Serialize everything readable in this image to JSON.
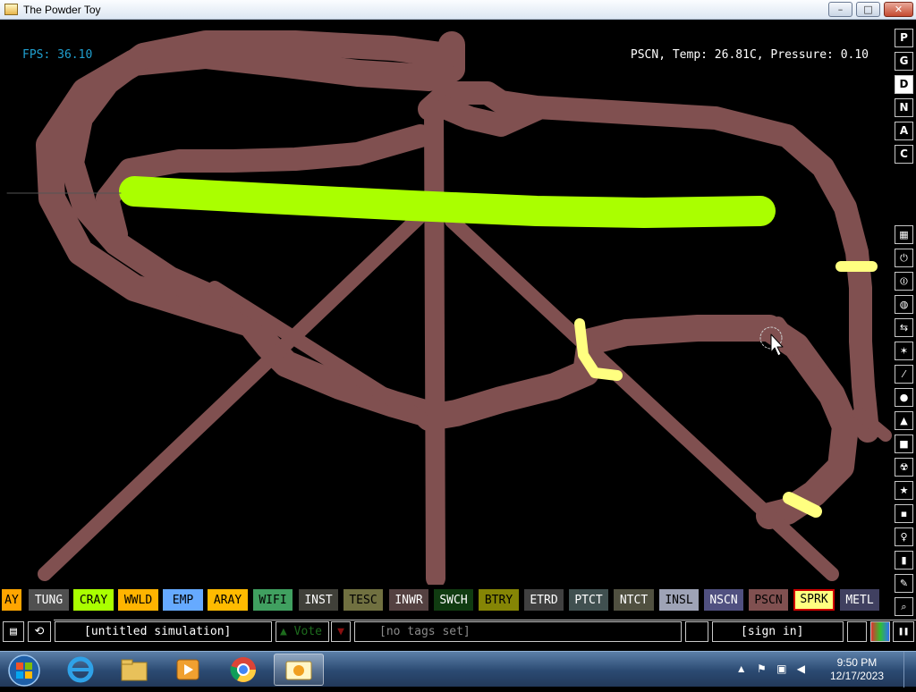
{
  "window": {
    "title": "The Powder Toy",
    "minimize": "–",
    "maximize": "□",
    "close": "✕"
  },
  "hud": {
    "fps": "FPS: 36.10",
    "info": "PSCN, Temp: 26.81C, Pressure: 0.10"
  },
  "right_toolbar": {
    "modes": [
      "P",
      "G",
      "D",
      "N",
      "A",
      "C"
    ],
    "selected_mode": "D",
    "categories": [
      {
        "name": "walls-icon",
        "glyph": "▦"
      },
      {
        "name": "electronics-icon",
        "glyph": "⏻"
      },
      {
        "name": "powered-icon",
        "glyph": "⏼"
      },
      {
        "name": "sensors-icon",
        "glyph": "◍"
      },
      {
        "name": "force-icon",
        "glyph": "⇆"
      },
      {
        "name": "explosives-icon",
        "glyph": "✶"
      },
      {
        "name": "gases-icon",
        "glyph": "⁄"
      },
      {
        "name": "liquids-icon",
        "glyph": "●"
      },
      {
        "name": "powders-icon",
        "glyph": "▲"
      },
      {
        "name": "solids-icon",
        "glyph": "■"
      },
      {
        "name": "radioactive-icon",
        "glyph": "☢"
      },
      {
        "name": "special-icon",
        "glyph": "★"
      },
      {
        "name": "life-icon",
        "glyph": "▪"
      },
      {
        "name": "tools-icon",
        "glyph": "♀"
      },
      {
        "name": "favorites-icon",
        "glyph": "▮"
      },
      {
        "name": "deco-icon",
        "glyph": "✎"
      },
      {
        "name": "search-icon",
        "glyph": "⌕"
      }
    ]
  },
  "elements": [
    {
      "label": "AY",
      "bg": "#ffa500",
      "fg": "#000000"
    },
    {
      "label": "TUNG",
      "bg": "#505050",
      "fg": "#ffffff"
    },
    {
      "label": "CRAY",
      "bg": "#aaff00",
      "fg": "#000000"
    },
    {
      "label": "WWLD",
      "bg": "#ffb400",
      "fg": "#000000"
    },
    {
      "label": "EMP",
      "bg": "#66aaff",
      "fg": "#000000"
    },
    {
      "label": "ARAY",
      "bg": "#ffbb00",
      "fg": "#000000"
    },
    {
      "label": "WIFI",
      "bg": "#40a060",
      "fg": "#000000"
    },
    {
      "label": "INST",
      "bg": "#404039",
      "fg": "#ffffff"
    },
    {
      "label": "TESC",
      "bg": "#707040",
      "fg": "#000000"
    },
    {
      "label": "INWR",
      "bg": "#544141",
      "fg": "#ffffff"
    },
    {
      "label": "SWCH",
      "bg": "#103b11",
      "fg": "#ffffff"
    },
    {
      "label": "BTRY",
      "bg": "#858505",
      "fg": "#000000"
    },
    {
      "label": "ETRD",
      "bg": "#404040",
      "fg": "#ffffff"
    },
    {
      "label": "PTCT",
      "bg": "#405050",
      "fg": "#ffffff"
    },
    {
      "label": "NTCT",
      "bg": "#505040",
      "fg": "#ffffff"
    },
    {
      "label": "INSL",
      "bg": "#9ea3b6",
      "fg": "#000000"
    },
    {
      "label": "NSCN",
      "bg": "#505080",
      "fg": "#ffffff"
    },
    {
      "label": "PSCN",
      "bg": "#805050",
      "fg": "#000000"
    },
    {
      "label": "SPRK",
      "bg": "#ffff80",
      "fg": "#000000",
      "selected": true
    },
    {
      "label": "METL",
      "bg": "#404060",
      "fg": "#ffffff"
    }
  ],
  "bottom_bar": {
    "open_icon": "▤",
    "reload_icon": "⟲",
    "save_name": "[untitled simulation]",
    "vote_label": "Vote",
    "vote_up_icon": "▲",
    "vote_down_icon": "▼",
    "tags": "[no tags set]",
    "sign_in": "[sign in]",
    "pause_icon": "❚❚"
  },
  "taskbar": {
    "time": "9:50 PM",
    "date": "12/17/2023",
    "tray_icons": "▲ ⚑ ▣ ◀"
  },
  "colors": {
    "hud_fps": "#20a0d0",
    "hud_info": "#ffffff",
    "pscn": "#805050",
    "cray": "#aaff00",
    "sprk": "#ffff80"
  }
}
